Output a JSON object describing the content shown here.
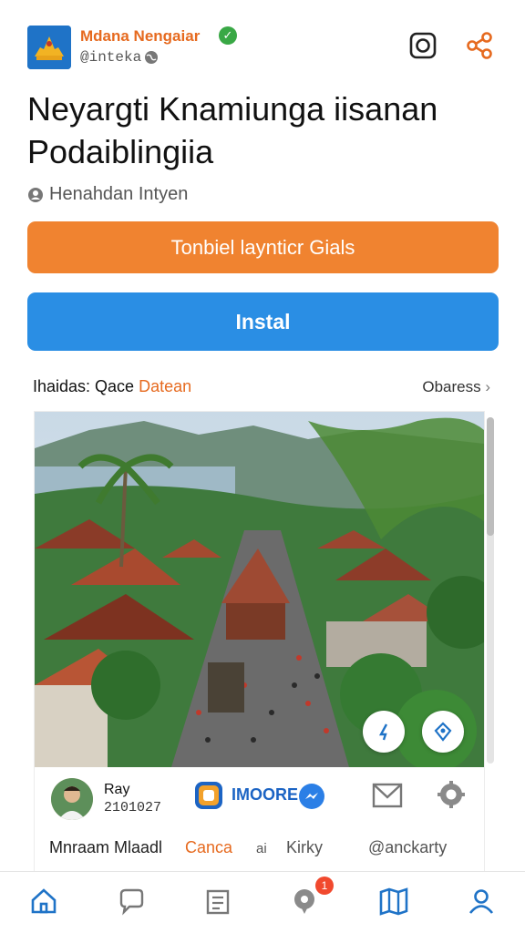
{
  "header": {
    "app_name": "Mdana Nengaiar",
    "handle": "@inteka",
    "logo_icon": "temple-emblem-icon",
    "actions": [
      "instagram-icon",
      "share-icon"
    ]
  },
  "title": "Neyargti Knamiunga iisanan Podaiblingiia",
  "subtitle": "Henahdan Intyen",
  "buttons": {
    "primary": "Tonbiel laynticr Gials",
    "install": "Instal"
  },
  "section": {
    "label_prefix": "Ihaidas: Qace",
    "label_highlight": "Datean",
    "link": "Obaress"
  },
  "card": {
    "author_name": "Ray",
    "author_date": "2101027",
    "brand_name": "IMOORE",
    "meta": [
      "Mnraam Mlaadl",
      "Canca",
      "ai",
      "Kirky",
      "@anckarty"
    ]
  },
  "nav": {
    "items": [
      "home-icon",
      "chat-icon",
      "clipboard-icon",
      "location-chat-icon",
      "map-book-icon",
      "profile-icon"
    ],
    "badge_count": "1"
  },
  "colors": {
    "accent_orange": "#f08330",
    "accent_blue": "#2a8ee4",
    "verified_green": "#39a845",
    "nav_blue": "#1f73c7"
  }
}
